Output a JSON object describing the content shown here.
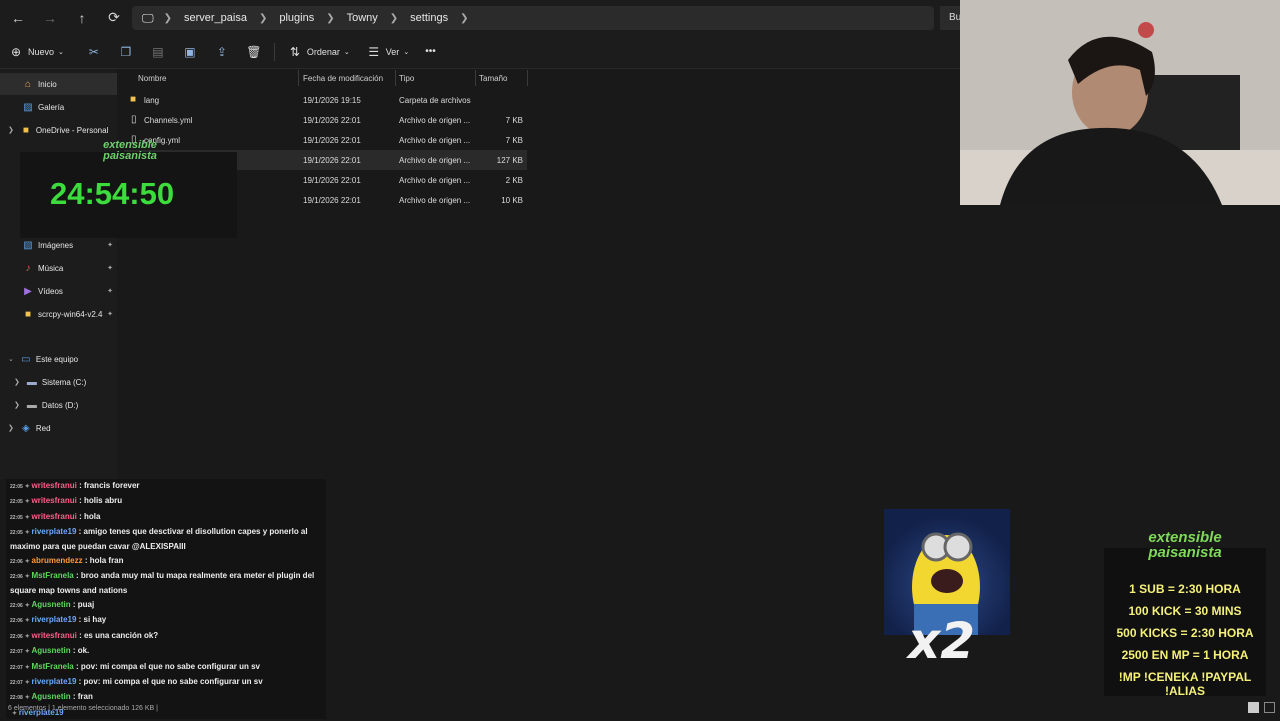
{
  "nav": {
    "back": "←",
    "forward": "→",
    "up": "↑",
    "refresh": "⟳"
  },
  "address": {
    "segments": [
      "server_paisa",
      "plugins",
      "Towny",
      "settings"
    ]
  },
  "search": {
    "label": "Bu"
  },
  "toolbar": {
    "new_label": "Nuevo",
    "sort_label": "Ordenar",
    "view_label": "Ver",
    "more_label": "•••"
  },
  "sidebar": {
    "items": [
      {
        "label": "Inicio"
      },
      {
        "label": "Galería"
      },
      {
        "label": "OneDrive - Personal"
      },
      {
        "label": "Imágenes"
      },
      {
        "label": "Música"
      },
      {
        "label": "Vídeos"
      },
      {
        "label": "scrcpy-win64-v2.4"
      },
      {
        "label": "Este equipo"
      },
      {
        "label": "Sistema (C:)"
      },
      {
        "label": "Datos (D:)"
      },
      {
        "label": "Red"
      }
    ]
  },
  "columns": {
    "name": "Nombre",
    "date": "Fecha de modificación",
    "type": "Tipo",
    "size": "Tamaño"
  },
  "files": [
    {
      "name": "lang",
      "date": "19/1/2026 19:15",
      "type": "Carpeta de archivos",
      "size": ""
    },
    {
      "name": "Channels.yml",
      "date": "19/1/2026 22:01",
      "type": "Archivo de origen ...",
      "size": "7 KB"
    },
    {
      "name": "config.yml",
      "date": "19/1/2026 22:01",
      "type": "Archivo de origen ...",
      "size": "7 KB"
    },
    {
      "name": "",
      "date": "19/1/2026 22:01",
      "type": "Archivo de origen ...",
      "size": "127 KB"
    },
    {
      "name": "",
      "date": "19/1/2026 22:01",
      "type": "Archivo de origen ...",
      "size": "2 KB"
    },
    {
      "name": "",
      "date": "19/1/2026 22:01",
      "type": "Archivo de origen ...",
      "size": "10 KB"
    }
  ],
  "overlay": {
    "timer": "24:54:50",
    "logo": "extensible paisanista"
  },
  "status": {
    "text": "6 elementos  |  1 elemento seleccionado  126 KB  |"
  },
  "chat": [
    {
      "ts": "22:05",
      "user": "writesfranui",
      "color": "#ff5c8a",
      "text": "francis forever"
    },
    {
      "ts": "22:05",
      "user": "writesfranui",
      "color": "#ff5c8a",
      "text": "holis abru"
    },
    {
      "ts": "22:05",
      "user": "writesfranui",
      "color": "#ff5c8a",
      "text": "hola"
    },
    {
      "ts": "22:05",
      "user": "riverplate19",
      "color": "#6ea8ff",
      "text": "amigo tenes que desctivar el disollution capes y ponerlo al maximo para que puedan cavar @ALEXISPAIII"
    },
    {
      "ts": "22:06",
      "user": "abrumendezz",
      "color": "#ff9a3c",
      "text": "hola fran"
    },
    {
      "ts": "22:06",
      "user": "MstFranela",
      "color": "#5fd65f",
      "text": "broo anda muy mal tu mapa realmente era meter el plugin del square map towns and nations"
    },
    {
      "ts": "22:06",
      "user": "Agusnetin",
      "color": "#5fd65f",
      "text": "puaj"
    },
    {
      "ts": "22:06",
      "user": "riverplate19",
      "color": "#6ea8ff",
      "text": "si hay"
    },
    {
      "ts": "22:06",
      "user": "writesfranui",
      "color": "#ff5c8a",
      "text": "es una canción ok?"
    },
    {
      "ts": "22:07",
      "user": "Agusnetin",
      "color": "#5fd65f",
      "text": "ok."
    },
    {
      "ts": "22:07",
      "user": "MstFranela",
      "color": "#5fd65f",
      "text": "pov: mi compa el que no sabe configurar un sv"
    },
    {
      "ts": "22:07",
      "user": "riverplate19",
      "color": "#6ea8ff",
      "text": "pov: mi compa el que no sabe configurar un sv"
    },
    {
      "ts": "22:08",
      "user": "Agusnetin",
      "color": "#5fd65f",
      "text": "fran"
    },
    {
      "ts": "",
      "user": "riverplate19",
      "color": "#6ea8ff",
      "text": ""
    }
  ],
  "emote": {
    "multiplier": "x2"
  },
  "goals": {
    "title": "extensible paisanista",
    "lines": [
      "1 SUB = 2:30 HORA",
      "100 KICK = 30 MINS",
      "500 KICKS = 2:30 HORA",
      "2500 EN MP = 1 HORA",
      "!MP !CENEKA !PAYPAL !ALIAS"
    ]
  }
}
